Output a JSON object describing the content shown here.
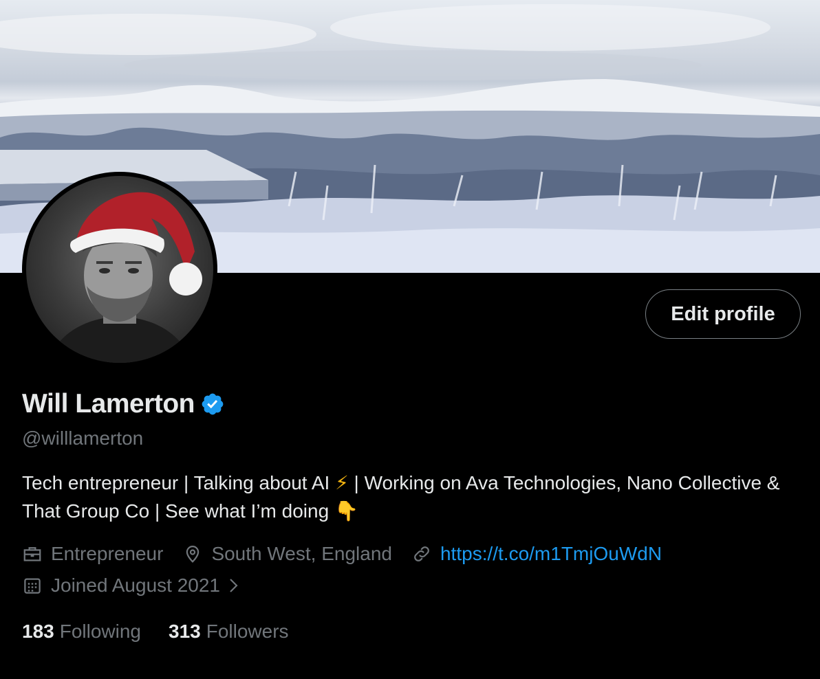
{
  "profile": {
    "display_name": "Will Lamerton",
    "handle": "@willlamerton",
    "verified": true,
    "edit_button_label": "Edit profile",
    "bio_part1": "Tech entrepreneur | Talking about AI ",
    "bio_emoji1": "⚡",
    "bio_part2": " | Working on Ava Technologies, Nano Collective & That Group Co | See what I’m doing ",
    "bio_emoji2": "👇",
    "profession": "Entrepreneur",
    "location": "South West, England",
    "website": "https://t.co/m1TmjOuWdN",
    "joined": "Joined August 2021",
    "following_count": "183",
    "following_label": "Following",
    "followers_count": "313",
    "followers_label": "Followers"
  },
  "icons": {
    "verified": "verified-badge-icon",
    "profession": "briefcase-icon",
    "location": "location-pin-icon",
    "website": "link-icon",
    "joined": "calendar-icon",
    "joined_chevron": "chevron-right-icon"
  },
  "colors": {
    "background": "#000000",
    "text_primary": "#e7e9ea",
    "text_secondary": "#71767b",
    "link": "#1d9bf0",
    "verified": "#1d9bf0"
  }
}
